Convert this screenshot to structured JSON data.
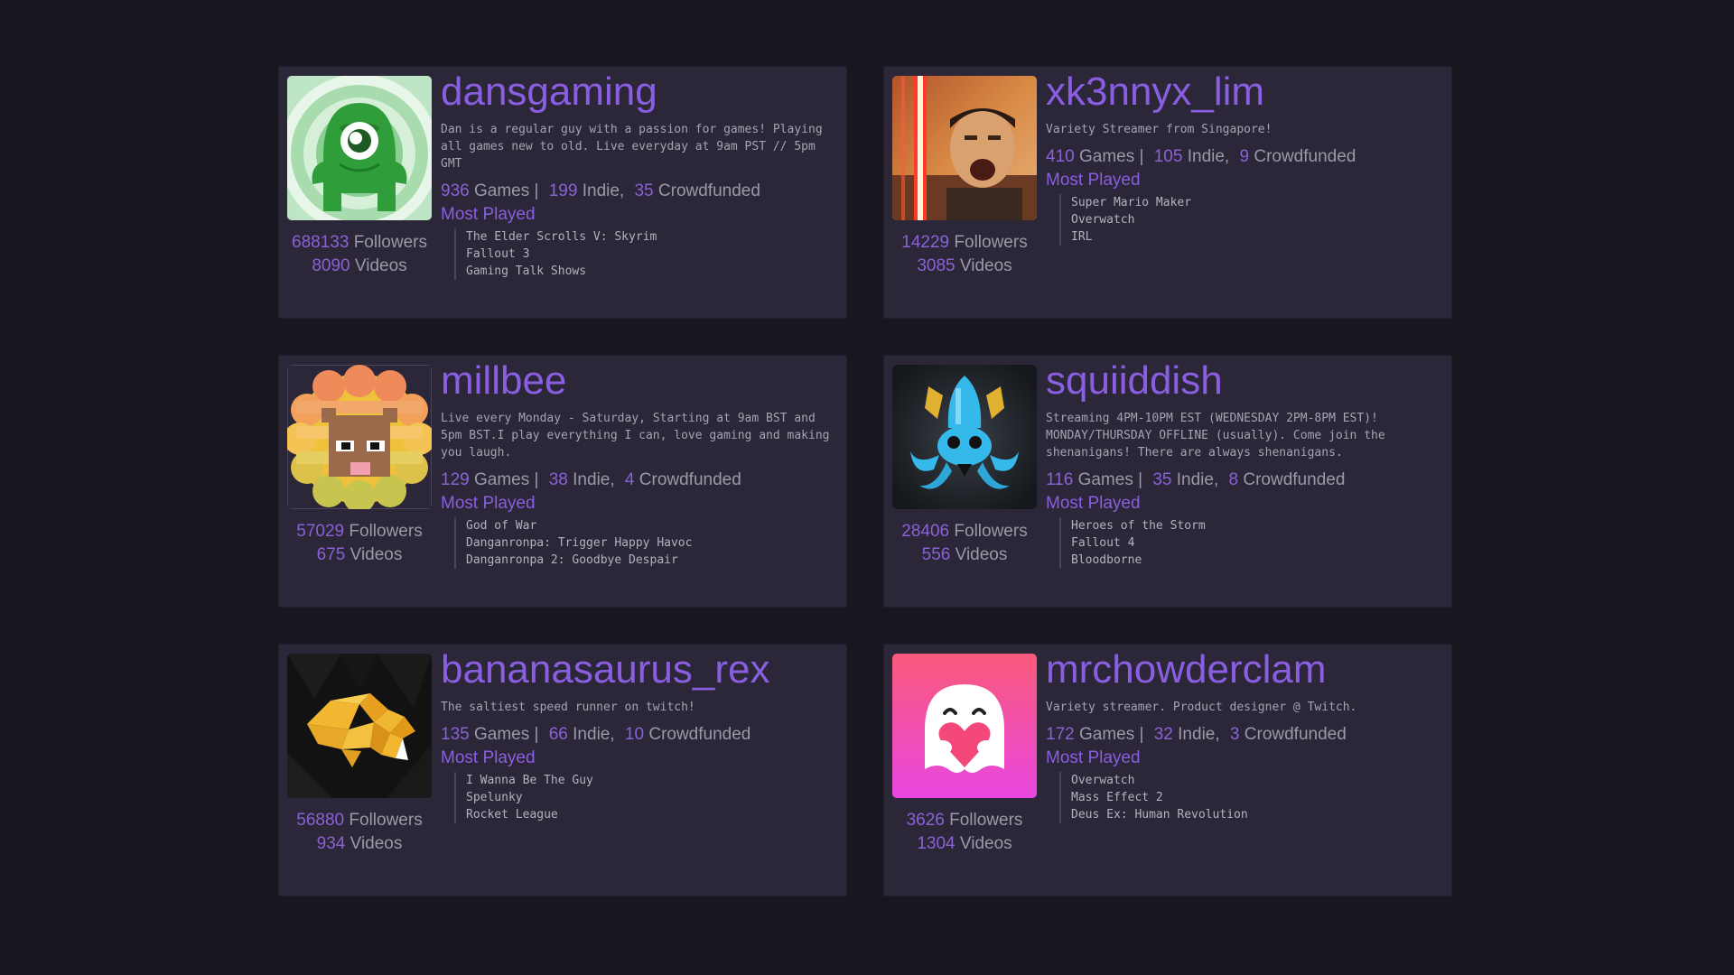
{
  "streamers": [
    {
      "name": "dansgaming",
      "description": "Dan is a regular guy with a passion for games! Playing all games new to old. Live everyday at 9am PST // 5pm GMT",
      "games": "936",
      "games_label": "Games |",
      "indie": "199",
      "indie_label": "Indie,",
      "crowdfunded": "35",
      "crowdfunded_label": "Crowdfunded",
      "most_played_label": "Most Played",
      "most_played": [
        "The Elder Scrolls V: Skyrim",
        "Fallout 3",
        "Gaming Talk Shows"
      ],
      "followers": "688133",
      "followers_label": "Followers",
      "videos": "8090",
      "videos_label": "Videos",
      "avatar_icon": "green-cyclops-icon"
    },
    {
      "name": "xk3nnyx_lim",
      "description": "Variety Streamer from Singapore!",
      "games": "410",
      "games_label": "Games |",
      "indie": "105",
      "indie_label": "Indie,",
      "crowdfunded": "9",
      "crowdfunded_label": "Crowdfunded",
      "most_played_label": "Most Played",
      "most_played": [
        "Super Mario Maker",
        "Overwatch",
        "IRL"
      ],
      "followers": "14229",
      "followers_label": "Followers",
      "videos": "3085",
      "videos_label": "Videos",
      "avatar_icon": "lightsaber-photo-icon"
    },
    {
      "name": "millbee",
      "description": "Live every Monday - Saturday, Starting at 9am BST and 5pm BST.I play everything I can, love gaming and making you laugh.",
      "games": "129",
      "games_label": "Games |",
      "indie": "38",
      "indie_label": "Indie,",
      "crowdfunded": "4",
      "crowdfunded_label": "Crowdfunded",
      "most_played_label": "Most Played",
      "most_played": [
        "God of War",
        "Danganronpa: Trigger Happy Havoc",
        "Danganronpa 2: Goodbye Despair"
      ],
      "followers": "57029",
      "followers_label": "Followers",
      "videos": "675",
      "videos_label": "Videos",
      "avatar_icon": "lion-icon"
    },
    {
      "name": "squiiddish",
      "description": "Streaming 4PM-10PM EST (WEDNESDAY 2PM-8PM EST)! MONDAY/THURSDAY OFFLINE (usually). Come join the shenanigans! There are always shenanigans.",
      "games": "116",
      "games_label": "Games |",
      "indie": "35",
      "indie_label": "Indie,",
      "crowdfunded": "8",
      "crowdfunded_label": "Crowdfunded",
      "most_played_label": "Most Played",
      "most_played": [
        "Heroes of the Storm",
        "Fallout 4",
        "Bloodborne"
      ],
      "followers": "28406",
      "followers_label": "Followers",
      "videos": "556",
      "videos_label": "Videos",
      "avatar_icon": "squid-icon"
    },
    {
      "name": "bananasaurus_rex",
      "description": "The saltiest speed runner on twitch!",
      "games": "135",
      "games_label": "Games |",
      "indie": "66",
      "indie_label": "Indie,",
      "crowdfunded": "10",
      "crowdfunded_label": "Crowdfunded",
      "most_played_label": "Most Played",
      "most_played": [
        "I Wanna Be The Guy",
        "Spelunky",
        "Rocket League"
      ],
      "followers": "56880",
      "followers_label": "Followers",
      "videos": "934",
      "videos_label": "Videos",
      "avatar_icon": "dinosaur-icon"
    },
    {
      "name": "mrchowderclam",
      "description": "Variety streamer. Product designer @ Twitch.",
      "games": "172",
      "games_label": "Games |",
      "indie": "32",
      "indie_label": "Indie,",
      "crowdfunded": "3",
      "crowdfunded_label": "Crowdfunded",
      "most_played_label": "Most Played",
      "most_played": [
        "Overwatch",
        "Mass Effect 2",
        "Deus Ex: Human Revolution"
      ],
      "followers": "3626",
      "followers_label": "Followers",
      "videos": "1304",
      "videos_label": "Videos",
      "avatar_icon": "ghost-heart-icon"
    }
  ],
  "colors": {
    "background": "#18161f",
    "card": "#2b2638",
    "accent": "#8a5ee0",
    "text_muted": "#9b98a8"
  }
}
